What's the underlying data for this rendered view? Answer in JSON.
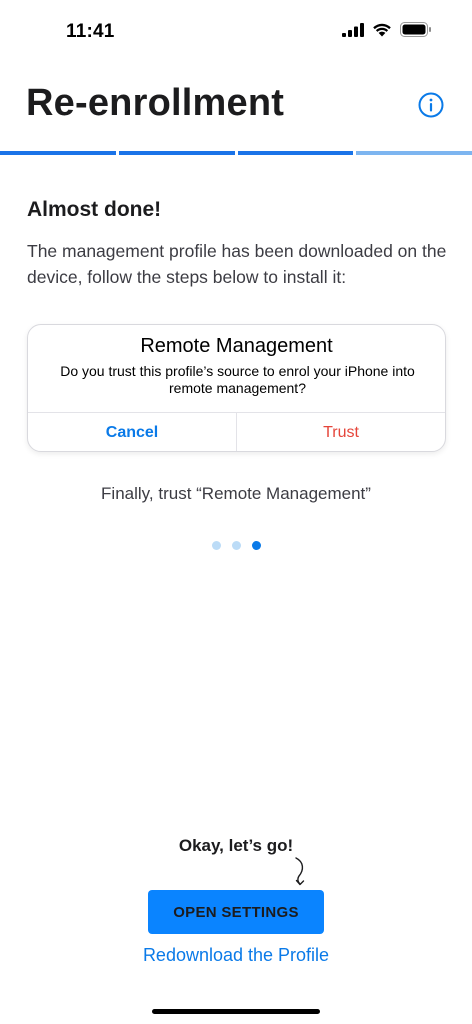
{
  "status_bar": {
    "time": "11:41",
    "icons": [
      "signal-icon",
      "wifi-icon",
      "battery-icon"
    ]
  },
  "header": {
    "title": "Re-enrollment",
    "info_icon": "info-icon"
  },
  "progress": {
    "total_steps": 4,
    "completed_steps": 3
  },
  "content": {
    "title": "Almost done!",
    "description": "The management profile has been downloaded on the device, follow the steps below to install it:"
  },
  "dialog": {
    "title": "Remote Management",
    "message": "Do you trust this profile’s source to enrol your iPhone into remote management?",
    "cancel_label": "Cancel",
    "trust_label": "Trust"
  },
  "step_caption": "Finally, trust “Remote Management”",
  "carousel": {
    "total": 3,
    "active_index": 2
  },
  "hint": "Okay, let’s go!",
  "actions": {
    "open_settings_label": "OPEN SETTINGS",
    "redownload_label": "Redownload the Profile"
  },
  "colors": {
    "accent": "#0a7ae8",
    "progress_done": "#1a73e8",
    "progress_pending": "#7db5f0",
    "trust_red": "#e5453a",
    "dot_inactive": "#bcdcf7",
    "primary_button": "#0a84ff"
  }
}
